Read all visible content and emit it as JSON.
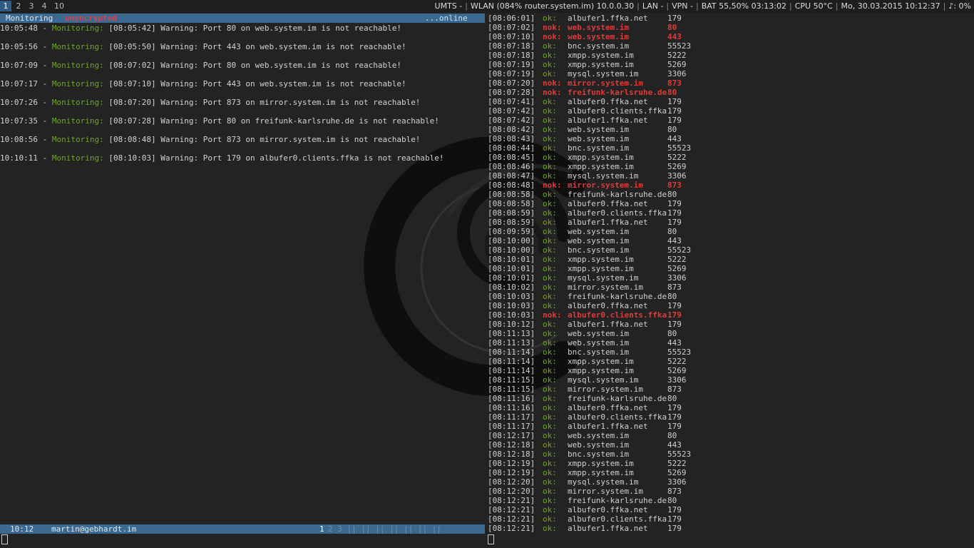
{
  "topbar": {
    "workspaces": [
      {
        "label": "1",
        "active": true
      },
      {
        "label": "2",
        "active": false
      },
      {
        "label": "3",
        "active": false
      },
      {
        "label": "4",
        "active": false
      },
      {
        "label": "10",
        "active": false
      }
    ],
    "status": {
      "umts": "UMTS -",
      "wlan": "WLAN (084% router.system.im) 10.0.0.30",
      "lan": "LAN -",
      "vpn": "VPN -",
      "battery": "BAT 55,50% 03:13:02",
      "cpu": "CPU 50°C",
      "datetime": "Mo, 30.03.2015 10:12:37",
      "volume": "♪: 0%"
    }
  },
  "left_pane": {
    "title": "Monitoring",
    "encryption": "unencrypted",
    "connection": "...online",
    "lines": [
      {
        "time": "10:05:48",
        "source": "Monitoring:",
        "message": "[08:05:42] Warning: Port 80 on web.system.im is not reachable!"
      },
      {
        "time": "10:05:56",
        "source": "Monitoring:",
        "message": "[08:05:50] Warning: Port 443 on web.system.im is not reachable!"
      },
      {
        "time": "10:07:09",
        "source": "Monitoring:",
        "message": "[08:07:02] Warning: Port 80 on web.system.im is not reachable!"
      },
      {
        "time": "10:07:17",
        "source": "Monitoring:",
        "message": "[08:07:10] Warning: Port 443 on web.system.im is not reachable!"
      },
      {
        "time": "10:07:26",
        "source": "Monitoring:",
        "message": "[08:07:20] Warning: Port 873 on mirror.system.im is not reachable!"
      },
      {
        "time": "10:07:35",
        "source": "Monitoring:",
        "message": "[08:07:28] Warning: Port 80 on freifunk-karlsruhe.de is not reachable!"
      },
      {
        "time": "10:08:56",
        "source": "Monitoring:",
        "message": "[08:08:48] Warning: Port 873 on mirror.system.im is not reachable!"
      },
      {
        "time": "10:10:11",
        "source": "Monitoring:",
        "message": "[08:10:03] Warning: Port 179 on albufer0.clients.ffka is not reachable!"
      }
    ],
    "statusbar": {
      "time": "10:12",
      "user": "martin@gebhardt.im",
      "active_window": "1",
      "windows": "2 3 || || || || || || ||"
    }
  },
  "right_pane": {
    "rows": [
      {
        "time": "[08:06:01]",
        "status": "ok:",
        "host": "albufer1.ffka.net",
        "port": "179"
      },
      {
        "time": "[08:07:02]",
        "status": "nok:",
        "host": "web.system.im",
        "port": "80"
      },
      {
        "time": "[08:07:10]",
        "status": "nok:",
        "host": "web.system.im",
        "port": "443"
      },
      {
        "time": "[08:07:18]",
        "status": "ok:",
        "host": "bnc.system.im",
        "port": "55523"
      },
      {
        "time": "[08:07:18]",
        "status": "ok:",
        "host": "xmpp.system.im",
        "port": "5222"
      },
      {
        "time": "[08:07:19]",
        "status": "ok:",
        "host": "xmpp.system.im",
        "port": "5269"
      },
      {
        "time": "[08:07:19]",
        "status": "ok:",
        "host": "mysql.system.im",
        "port": "3306"
      },
      {
        "time": "[08:07:20]",
        "status": "nok:",
        "host": "mirror.system.im",
        "port": "873"
      },
      {
        "time": "[08:07:28]",
        "status": "nok:",
        "host": "freifunk-karlsruhe.de",
        "port": "80"
      },
      {
        "time": "[08:07:41]",
        "status": "ok:",
        "host": "albufer0.ffka.net",
        "port": "179"
      },
      {
        "time": "[08:07:42]",
        "status": "ok:",
        "host": "albufer0.clients.ffka",
        "port": "179"
      },
      {
        "time": "[08:07:42]",
        "status": "ok:",
        "host": "albufer1.ffka.net",
        "port": "179"
      },
      {
        "time": "[08:08:42]",
        "status": "ok:",
        "host": "web.system.im",
        "port": "80"
      },
      {
        "time": "[08:08:43]",
        "status": "ok:",
        "host": "web.system.im",
        "port": "443"
      },
      {
        "time": "[08:08:44]",
        "status": "ok:",
        "host": "bnc.system.im",
        "port": "55523"
      },
      {
        "time": "[08:08:45]",
        "status": "ok:",
        "host": "xmpp.system.im",
        "port": "5222"
      },
      {
        "time": "[08:08:46]",
        "status": "ok:",
        "host": "xmpp.system.im",
        "port": "5269"
      },
      {
        "time": "[08:08:47]",
        "status": "ok:",
        "host": "mysql.system.im",
        "port": "3306"
      },
      {
        "time": "[08:08:48]",
        "status": "nok:",
        "host": "mirror.system.im",
        "port": "873"
      },
      {
        "time": "[08:08:58]",
        "status": "ok:",
        "host": "freifunk-karlsruhe.de",
        "port": "80"
      },
      {
        "time": "[08:08:58]",
        "status": "ok:",
        "host": "albufer0.ffka.net",
        "port": "179"
      },
      {
        "time": "[08:08:59]",
        "status": "ok:",
        "host": "albufer0.clients.ffka",
        "port": "179"
      },
      {
        "time": "[08:08:59]",
        "status": "ok:",
        "host": "albufer1.ffka.net",
        "port": "179"
      },
      {
        "time": "[08:09:59]",
        "status": "ok:",
        "host": "web.system.im",
        "port": "80"
      },
      {
        "time": "[08:10:00]",
        "status": "ok:",
        "host": "web.system.im",
        "port": "443"
      },
      {
        "time": "[08:10:00]",
        "status": "ok:",
        "host": "bnc.system.im",
        "port": "55523"
      },
      {
        "time": "[08:10:01]",
        "status": "ok:",
        "host": "xmpp.system.im",
        "port": "5222"
      },
      {
        "time": "[08:10:01]",
        "status": "ok:",
        "host": "xmpp.system.im",
        "port": "5269"
      },
      {
        "time": "[08:10:01]",
        "status": "ok:",
        "host": "mysql.system.im",
        "port": "3306"
      },
      {
        "time": "[08:10:02]",
        "status": "ok:",
        "host": "mirror.system.im",
        "port": "873"
      },
      {
        "time": "[08:10:03]",
        "status": "ok:",
        "host": "freifunk-karlsruhe.de",
        "port": "80"
      },
      {
        "time": "[08:10:03]",
        "status": "ok:",
        "host": "albufer0.ffka.net",
        "port": "179"
      },
      {
        "time": "[08:10:03]",
        "status": "nok:",
        "host": "albufer0.clients.ffka",
        "port": "179"
      },
      {
        "time": "[08:10:12]",
        "status": "ok:",
        "host": "albufer1.ffka.net",
        "port": "179"
      },
      {
        "time": "[08:11:13]",
        "status": "ok:",
        "host": "web.system.im",
        "port": "80"
      },
      {
        "time": "[08:11:13]",
        "status": "ok:",
        "host": "web.system.im",
        "port": "443"
      },
      {
        "time": "[08:11:14]",
        "status": "ok:",
        "host": "bnc.system.im",
        "port": "55523"
      },
      {
        "time": "[08:11:14]",
        "status": "ok:",
        "host": "xmpp.system.im",
        "port": "5222"
      },
      {
        "time": "[08:11:14]",
        "status": "ok:",
        "host": "xmpp.system.im",
        "port": "5269"
      },
      {
        "time": "[08:11:15]",
        "status": "ok:",
        "host": "mysql.system.im",
        "port": "3306"
      },
      {
        "time": "[08:11:15]",
        "status": "ok:",
        "host": "mirror.system.im",
        "port": "873"
      },
      {
        "time": "[08:11:16]",
        "status": "ok:",
        "host": "freifunk-karlsruhe.de",
        "port": "80"
      },
      {
        "time": "[08:11:16]",
        "status": "ok:",
        "host": "albufer0.ffka.net",
        "port": "179"
      },
      {
        "time": "[08:11:17]",
        "status": "ok:",
        "host": "albufer0.clients.ffka",
        "port": "179"
      },
      {
        "time": "[08:11:17]",
        "status": "ok:",
        "host": "albufer1.ffka.net",
        "port": "179"
      },
      {
        "time": "[08:12:17]",
        "status": "ok:",
        "host": "web.system.im",
        "port": "80"
      },
      {
        "time": "[08:12:18]",
        "status": "ok:",
        "host": "web.system.im",
        "port": "443"
      },
      {
        "time": "[08:12:18]",
        "status": "ok:",
        "host": "bnc.system.im",
        "port": "55523"
      },
      {
        "time": "[08:12:19]",
        "status": "ok:",
        "host": "xmpp.system.im",
        "port": "5222"
      },
      {
        "time": "[08:12:19]",
        "status": "ok:",
        "host": "xmpp.system.im",
        "port": "5269"
      },
      {
        "time": "[08:12:20]",
        "status": "ok:",
        "host": "mysql.system.im",
        "port": "3306"
      },
      {
        "time": "[08:12:20]",
        "status": "ok:",
        "host": "mirror.system.im",
        "port": "873"
      },
      {
        "time": "[08:12:21]",
        "status": "ok:",
        "host": "freifunk-karlsruhe.de",
        "port": "80"
      },
      {
        "time": "[08:12:21]",
        "status": "ok:",
        "host": "albufer0.ffka.net",
        "port": "179"
      },
      {
        "time": "[08:12:21]",
        "status": "ok:",
        "host": "albufer0.clients.ffka",
        "port": "179"
      },
      {
        "time": "[08:12:21]",
        "status": "ok:",
        "host": "albufer1.ffka.net",
        "port": "179"
      }
    ]
  },
  "colors": {
    "ok": "#6fa622",
    "nok": "#e03a3a",
    "statusbar": "#3a6a92",
    "workspace_active": "#2f5c86"
  },
  "icons": {
    "wallpaper": "debian-swirl-logo"
  }
}
